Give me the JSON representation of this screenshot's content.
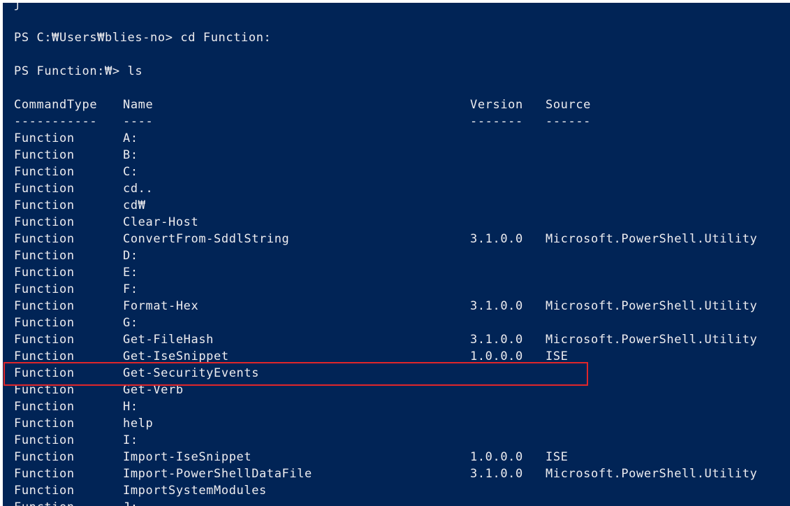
{
  "console": {
    "top_fragment": "ʃ",
    "prompt1": "PS C:₩Users₩blies-no> cd Function:",
    "prompt2": "PS Function:₩> ls",
    "headers": {
      "type": "CommandType",
      "name": "Name",
      "version": "Version",
      "source": "Source"
    },
    "underlines": {
      "type": "-----------",
      "name": "----",
      "version": "-------",
      "source": "------"
    },
    "rows": [
      {
        "type": "Function",
        "name": "A:",
        "version": "",
        "source": ""
      },
      {
        "type": "Function",
        "name": "B:",
        "version": "",
        "source": ""
      },
      {
        "type": "Function",
        "name": "C:",
        "version": "",
        "source": ""
      },
      {
        "type": "Function",
        "name": "cd..",
        "version": "",
        "source": ""
      },
      {
        "type": "Function",
        "name": "cd₩",
        "version": "",
        "source": ""
      },
      {
        "type": "Function",
        "name": "Clear-Host",
        "version": "",
        "source": ""
      },
      {
        "type": "Function",
        "name": "ConvertFrom-SddlString",
        "version": "3.1.0.0",
        "source": "Microsoft.PowerShell.Utility"
      },
      {
        "type": "Function",
        "name": "D:",
        "version": "",
        "source": ""
      },
      {
        "type": "Function",
        "name": "E:",
        "version": "",
        "source": ""
      },
      {
        "type": "Function",
        "name": "F:",
        "version": "",
        "source": ""
      },
      {
        "type": "Function",
        "name": "Format-Hex",
        "version": "3.1.0.0",
        "source": "Microsoft.PowerShell.Utility"
      },
      {
        "type": "Function",
        "name": "G:",
        "version": "",
        "source": ""
      },
      {
        "type": "Function",
        "name": "Get-FileHash",
        "version": "3.1.0.0",
        "source": "Microsoft.PowerShell.Utility"
      },
      {
        "type": "Function",
        "name": "Get-IseSnippet",
        "version": "1.0.0.0",
        "source": "ISE"
      },
      {
        "type": "Function",
        "name": "Get-SecurityEvents",
        "version": "",
        "source": ""
      },
      {
        "type": "Function",
        "name": "Get-Verb",
        "version": "",
        "source": ""
      },
      {
        "type": "Function",
        "name": "H:",
        "version": "",
        "source": ""
      },
      {
        "type": "Function",
        "name": "help",
        "version": "",
        "source": ""
      },
      {
        "type": "Function",
        "name": "I:",
        "version": "",
        "source": ""
      },
      {
        "type": "Function",
        "name": "Import-IseSnippet",
        "version": "1.0.0.0",
        "source": "ISE"
      },
      {
        "type": "Function",
        "name": "Import-PowerShellDataFile",
        "version": "3.1.0.0",
        "source": "Microsoft.PowerShell.Utility"
      },
      {
        "type": "Function",
        "name": "ImportSystemModules",
        "version": "",
        "source": ""
      },
      {
        "type": "Function",
        "name": "J:",
        "version": "",
        "source": ""
      }
    ]
  },
  "colors": {
    "background": "#012456",
    "text": "#eeedf0",
    "highlight": "#e0262a"
  }
}
